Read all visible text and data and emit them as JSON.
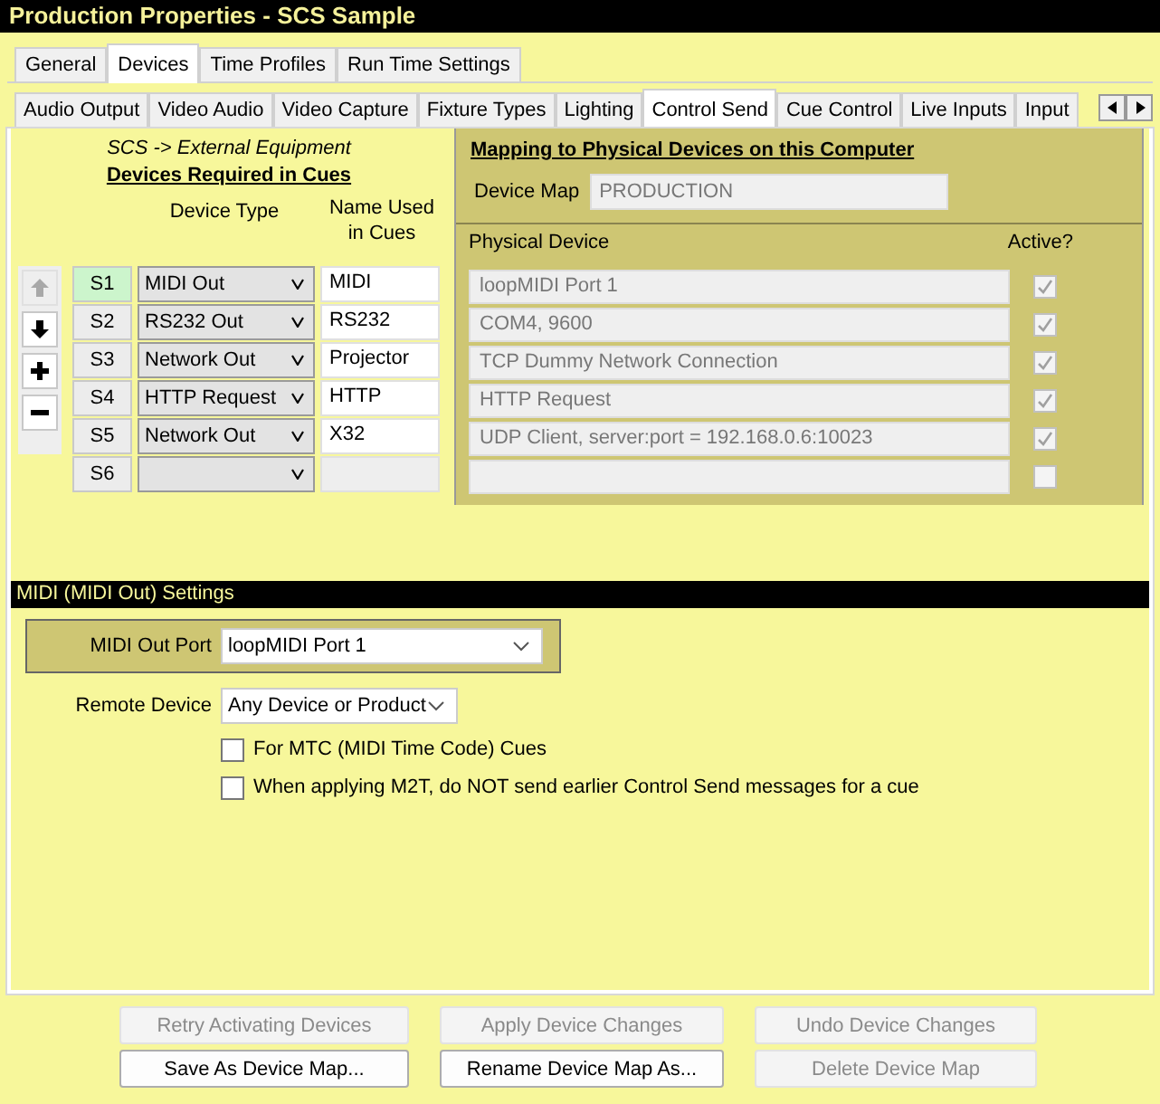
{
  "title": "Production Properties - SCS Sample",
  "top_tabs": [
    {
      "label": "General",
      "selected": false
    },
    {
      "label": "Devices",
      "selected": true
    },
    {
      "label": "Time Profiles",
      "selected": false
    },
    {
      "label": "Run Time Settings",
      "selected": false
    }
  ],
  "sub_tabs": [
    {
      "label": "Audio Output",
      "selected": false
    },
    {
      "label": "Video Audio",
      "selected": false
    },
    {
      "label": "Video Capture",
      "selected": false
    },
    {
      "label": "Fixture Types",
      "selected": false
    },
    {
      "label": "Lighting",
      "selected": false
    },
    {
      "label": "Control Send",
      "selected": true
    },
    {
      "label": "Cue Control",
      "selected": false
    },
    {
      "label": "Live Inputs",
      "selected": false
    },
    {
      "label": "Input",
      "selected": false
    }
  ],
  "devices_panel": {
    "direction": "SCS -> External Equipment",
    "heading": "Devices Required in Cues",
    "column_1": "Device Type",
    "column_2": "Name Used in Cues",
    "tools": [
      {
        "kind": "up",
        "disabled": true
      },
      {
        "kind": "down",
        "disabled": false
      },
      {
        "kind": "add",
        "disabled": false
      },
      {
        "kind": "remove",
        "disabled": false
      }
    ],
    "rows": [
      {
        "id": "S1",
        "selected": true,
        "type": "MIDI Out",
        "name": "MIDI"
      },
      {
        "id": "S2",
        "selected": false,
        "type": "RS232 Out",
        "name": "RS232"
      },
      {
        "id": "S3",
        "selected": false,
        "type": "Network Out",
        "name": "Projector"
      },
      {
        "id": "S4",
        "selected": false,
        "type": "HTTP Request",
        "name": "HTTP"
      },
      {
        "id": "S5",
        "selected": false,
        "type": "Network Out",
        "name": "X32"
      },
      {
        "id": "S6",
        "selected": false
      }
    ]
  },
  "mapping_panel": {
    "heading": "Mapping to Physical Devices on this Computer",
    "device_map_label": "Device Map",
    "device_map": "PRODUCTION",
    "column_1": "Physical Device",
    "column_2": "Active?",
    "rows": [
      {
        "device": "loopMIDI Port 1",
        "active": true
      },
      {
        "device": "COM4, 9600",
        "active": true
      },
      {
        "device": "TCP Dummy Network Connection",
        "active": true
      },
      {
        "device": "HTTP Request",
        "active": true
      },
      {
        "device": "UDP Client, server:port = 192.168.0.6:10023",
        "active": true
      },
      {
        "active": false
      }
    ]
  },
  "settings": {
    "header": "MIDI (MIDI Out) Settings",
    "midi_out_port_label": "MIDI Out Port",
    "midi_out_port": "loopMIDI Port 1",
    "remote_device_label": "Remote Device",
    "remote_device": "Any Device or Product",
    "checkboxes": [
      {
        "label": "For MTC (MIDI Time Code) Cues",
        "checked": false
      },
      {
        "label": "When applying M2T, do NOT send earlier Control Send messages for a cue",
        "checked": false
      }
    ]
  },
  "buttons": [
    {
      "label": "Retry Activating Devices",
      "disabled": true
    },
    {
      "label": "Apply Device Changes",
      "disabled": true
    },
    {
      "label": "Undo Device Changes",
      "disabled": true
    },
    {
      "label": "Save As Device Map...",
      "disabled": false
    },
    {
      "label": "Rename Device Map As...",
      "disabled": false
    },
    {
      "label": "Delete Device Map",
      "disabled": true
    }
  ]
}
